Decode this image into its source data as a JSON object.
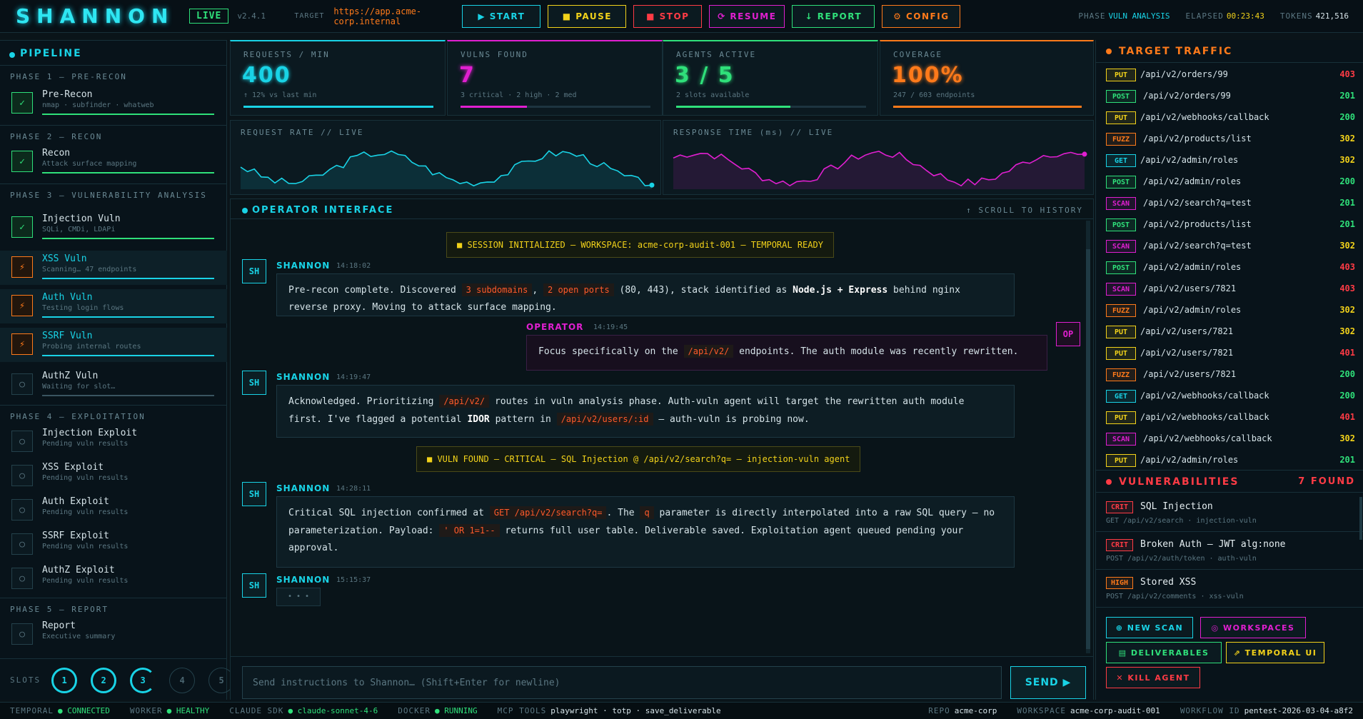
{
  "header": {
    "logo": "SHANNON",
    "live": "LIVE",
    "version": "v2.4.1",
    "target_label": "TARGET",
    "target": "https://app.acme-corp.internal",
    "buttons": [
      {
        "label": "▶ START",
        "color": "#19d3e6"
      },
      {
        "label": "■ PAUSE",
        "color": "#f2d21a"
      },
      {
        "label": "■ STOP",
        "color": "#ff3b45"
      },
      {
        "label": "⟳ RESUME",
        "color": "#e01fd0"
      },
      {
        "label": "↓ REPORT",
        "color": "#2fe07a"
      },
      {
        "label": "⚙ CONFIG",
        "color": "#ff7a1a"
      }
    ],
    "phase_label": "PHASE",
    "phase": "VULN ANALYSIS",
    "elapsed_label": "ELAPSED",
    "elapsed": "00:23:43",
    "tokens_label": "TOKENS",
    "tokens": "421,516"
  },
  "pipeline": {
    "title": "PIPELINE",
    "phases": [
      {
        "label": "PHASE 1 — PRE-RECON",
        "steps": [
          {
            "name": "Pre-Recon",
            "sub": "nmap · subfinder · whatweb",
            "state": "done"
          }
        ]
      },
      {
        "label": "PHASE 2 — RECON",
        "steps": [
          {
            "name": "Recon",
            "sub": "Attack surface mapping",
            "state": "done"
          }
        ]
      },
      {
        "label": "PHASE 3 — VULNERABILITY ANALYSIS",
        "steps": [
          {
            "name": "Injection Vuln",
            "sub": "SQLi, CMDi, LDAPi",
            "state": "done"
          },
          {
            "name": "XSS Vuln",
            "sub": "Scanning… 47 endpoints",
            "state": "active"
          },
          {
            "name": "Auth Vuln",
            "sub": "Testing login flows",
            "state": "active"
          },
          {
            "name": "SSRF Vuln",
            "sub": "Probing internal routes",
            "state": "active"
          },
          {
            "name": "AuthZ Vuln",
            "sub": "Waiting for slot…",
            "state": "wait"
          }
        ]
      },
      {
        "label": "PHASE 4 — EXPLOITATION",
        "steps": [
          {
            "name": "Injection Exploit",
            "sub": "Pending vuln results",
            "state": "pending"
          },
          {
            "name": "XSS Exploit",
            "sub": "Pending vuln results",
            "state": "pending"
          },
          {
            "name": "Auth Exploit",
            "sub": "Pending vuln results",
            "state": "pending"
          },
          {
            "name": "SSRF Exploit",
            "sub": "Pending vuln results",
            "state": "pending"
          },
          {
            "name": "AuthZ Exploit",
            "sub": "Pending vuln results",
            "state": "pending"
          }
        ]
      },
      {
        "label": "PHASE 5 — REPORT",
        "steps": [
          {
            "name": "Report",
            "sub": "Executive summary",
            "state": "pending"
          }
        ]
      }
    ],
    "slots_label": "SLOTS",
    "slots": [
      "1",
      "2",
      "3",
      "4",
      "5"
    ]
  },
  "stats": [
    {
      "label": "REQUESTS / MIN",
      "value": "400",
      "sub": "↑ 12% vs last min",
      "color": "#19d3e6",
      "progress": 1.0
    },
    {
      "label": "VULNS FOUND",
      "value": "7",
      "sub": "3 critical · 2 high · 2 med",
      "color": "#e01fd0",
      "progress": 0.35
    },
    {
      "label": "AGENTS ACTIVE",
      "value": "3 / 5",
      "sub": "2 slots available",
      "color": "#2fe07a",
      "progress": 0.6
    },
    {
      "label": "COVERAGE",
      "value": "100%",
      "sub": "247 / 603 endpoints",
      "color": "#ff7a1a",
      "progress": 1.0
    }
  ],
  "charts": [
    {
      "label": "REQUEST RATE // LIVE",
      "color": "#19d3e6"
    },
    {
      "label": "RESPONSE TIME (ms) // LIVE",
      "color": "#e01fd0"
    }
  ],
  "operator": {
    "title": "OPERATOR INTERFACE",
    "scroll": "↑ SCROLL TO HISTORY",
    "sys1": "■ SESSION INITIALIZED — WORKSPACE: acme-corp-audit-001 — TEMPORAL READY",
    "sys2": "■ VULN FOUND — CRITICAL — SQL Injection @ /api/v2/search?q= — injection-vuln agent",
    "msgs": [
      {
        "who": "SHANNON",
        "time": "14:18:02",
        "av": "SH",
        "parts": [
          "Pre-recon complete. Discovered ",
          "3 subdomains",
          ", ",
          "2 open ports",
          " (80, 443), stack identified as ",
          "Node.js + Express",
          " behind nginx reverse proxy. Moving to attack surface mapping."
        ]
      },
      {
        "who": "OPERATOR",
        "time": "14:19:45",
        "av": "OP",
        "parts": [
          "Focus specifically on the ",
          "/api/v2/",
          " endpoints. The auth module was recently rewritten."
        ]
      },
      {
        "who": "SHANNON",
        "time": "14:19:47",
        "av": "SH",
        "parts": [
          "Acknowledged. Prioritizing ",
          "/api/v2/",
          " routes in vuln analysis phase. Auth-vuln agent will target the rewritten auth module first. I've flagged a potential ",
          "IDOR",
          " pattern in ",
          "/api/v2/users/:id",
          " — auth-vuln is probing now."
        ]
      },
      {
        "who": "SHANNON",
        "time": "14:28:11",
        "av": "SH",
        "parts": [
          "Critical SQL injection confirmed at ",
          "GET /api/v2/search?q=",
          ". The ",
          "q",
          " parameter is directly interpolated into a raw SQL query — no parameterization. Payload: ",
          "' OR 1=1--",
          " returns full user table. Deliverable saved. Exploitation agent queued pending your approval."
        ]
      },
      {
        "who": "SHANNON",
        "time": "15:15:37",
        "av": "SH",
        "parts": [
          "• • •"
        ]
      }
    ],
    "placeholder": "Send instructions to Shannon… (Shift+Enter for newline)",
    "send": "SEND ▶"
  },
  "traffic": {
    "title": "TARGET TRAFFIC",
    "rows": [
      {
        "m": "PUT",
        "p": "/api/v2/orders/99",
        "c": "403"
      },
      {
        "m": "POST",
        "p": "/api/v2/orders/99",
        "c": "201"
      },
      {
        "m": "PUT",
        "p": "/api/v2/webhooks/callback",
        "c": "200"
      },
      {
        "m": "FUZZ",
        "p": "/api/v2/products/list",
        "c": "302"
      },
      {
        "m": "GET",
        "p": "/api/v2/admin/roles",
        "c": "302"
      },
      {
        "m": "POST",
        "p": "/api/v2/admin/roles",
        "c": "200"
      },
      {
        "m": "SCAN",
        "p": "/api/v2/search?q=test",
        "c": "201"
      },
      {
        "m": "POST",
        "p": "/api/v2/products/list",
        "c": "201"
      },
      {
        "m": "SCAN",
        "p": "/api/v2/search?q=test",
        "c": "302"
      },
      {
        "m": "POST",
        "p": "/api/v2/admin/roles",
        "c": "403"
      },
      {
        "m": "SCAN",
        "p": "/api/v2/users/7821",
        "c": "403"
      },
      {
        "m": "FUZZ",
        "p": "/api/v2/admin/roles",
        "c": "302"
      },
      {
        "m": "PUT",
        "p": "/api/v2/users/7821",
        "c": "302"
      },
      {
        "m": "PUT",
        "p": "/api/v2/users/7821",
        "c": "401"
      },
      {
        "m": "FUZZ",
        "p": "/api/v2/users/7821",
        "c": "200"
      },
      {
        "m": "GET",
        "p": "/api/v2/webhooks/callback",
        "c": "200"
      },
      {
        "m": "PUT",
        "p": "/api/v2/webhooks/callback",
        "c": "401"
      },
      {
        "m": "SCAN",
        "p": "/api/v2/webhooks/callback",
        "c": "302"
      },
      {
        "m": "PUT",
        "p": "/api/v2/admin/roles",
        "c": "201"
      }
    ]
  },
  "vulns": {
    "title": "VULNERABILITIES",
    "count": "7 FOUND",
    "items": [
      {
        "sev": "CRIT",
        "title": "SQL Injection",
        "sub": "GET /api/v2/search · injection-vuln"
      },
      {
        "sev": "CRIT",
        "title": "Broken Auth — JWT alg:none",
        "sub": "POST /api/v2/auth/token · auth-vuln"
      },
      {
        "sev": "HIGH",
        "title": "Stored XSS",
        "sub": "POST /api/v2/comments · xss-vuln"
      }
    ]
  },
  "actions": [
    {
      "label": "⊕ NEW SCAN",
      "color": "#19d3e6"
    },
    {
      "label": "◎ WORKSPACES",
      "color": "#e01fd0"
    },
    {
      "label": "▤ DELIVERABLES",
      "color": "#2fe07a"
    },
    {
      "label": "⇗ TEMPORAL UI",
      "color": "#f2d21a"
    },
    {
      "label": "✕ KILL AGENT",
      "color": "#ff3b45"
    }
  ],
  "footer": [
    {
      "k": "TEMPORAL",
      "v": "● CONNECTED",
      "c": "#2fe07a"
    },
    {
      "k": "WORKER",
      "v": "● HEALTHY",
      "c": "#2fe07a"
    },
    {
      "k": "CLAUDE SDK",
      "v": "● claude-sonnet-4-6",
      "c": "#2fe07a"
    },
    {
      "k": "DOCKER",
      "v": "● RUNNING",
      "c": "#2fe07a"
    },
    {
      "k": "MCP TOOLS",
      "v": "playwright · totp · save_deliverable",
      "c": "#d5e3e8"
    }
  ],
  "footer_right": [
    {
      "k": "REPO",
      "v": "acme-corp"
    },
    {
      "k": "WORKSPACE",
      "v": "acme-corp-audit-001"
    },
    {
      "k": "WORKFLOW ID",
      "v": "pentest-2026-03-04-a8f2"
    }
  ]
}
